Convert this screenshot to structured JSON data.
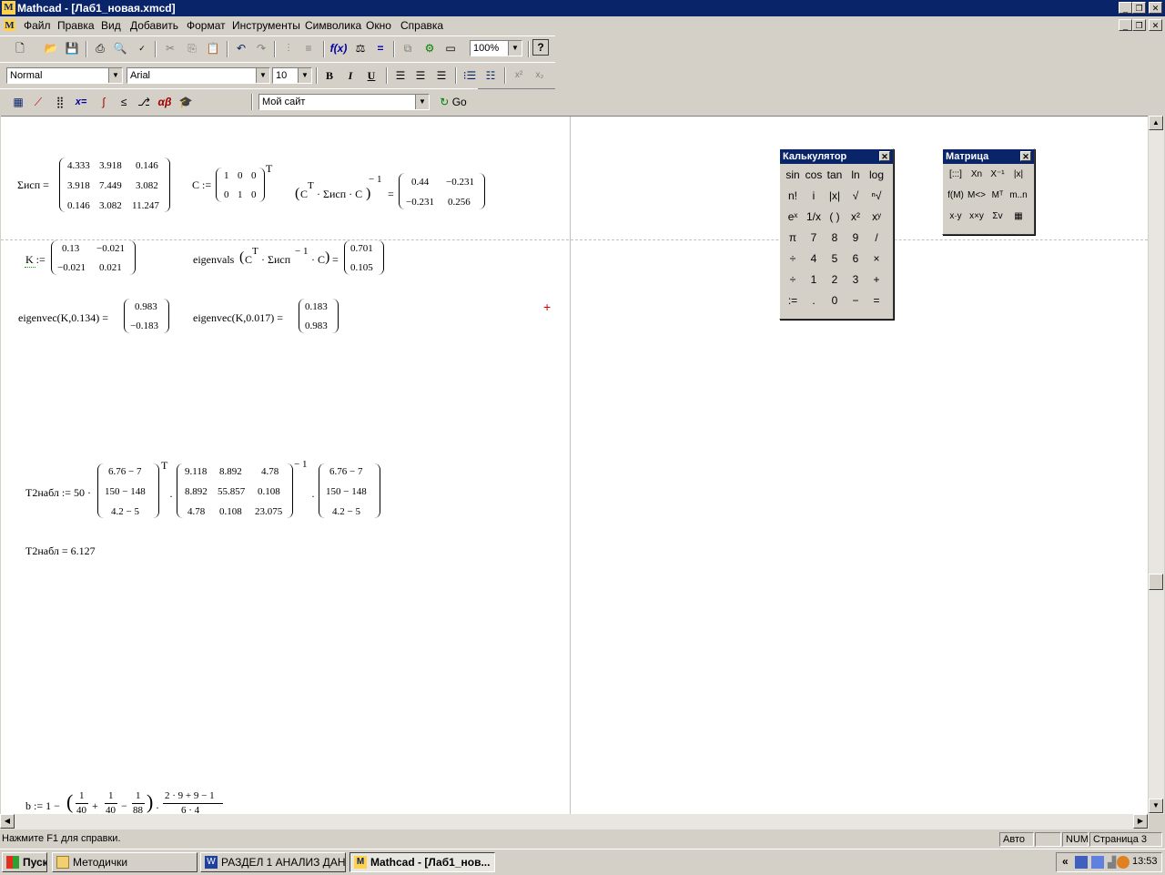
{
  "window": {
    "title": "Mathcad - [Лаб1_новая.xmcd]"
  },
  "menu": [
    "Файл",
    "Правка",
    "Вид",
    "Добавить",
    "Формат",
    "Инструменты",
    "Символика",
    "Окно",
    "Справка"
  ],
  "toolbar": {
    "zoom": "100%",
    "help": "?"
  },
  "format": {
    "style": "Normal",
    "font": "Arial",
    "size": "10",
    "bold": "B",
    "italic": "I",
    "underline": "U"
  },
  "math_toolbar": {
    "resource": "Мой сайт",
    "go": "Go"
  },
  "worksheet": {
    "sigma_lhs": "Σисп =",
    "sigma": [
      [
        "4.333",
        "3.918",
        "0.146"
      ],
      [
        "3.918",
        "7.449",
        "3.082"
      ],
      [
        "0.146",
        "3.082",
        "11.247"
      ]
    ],
    "c_lhs": "C :=",
    "c": [
      [
        "1",
        "0",
        "0"
      ],
      [
        "0",
        "1",
        "0"
      ]
    ],
    "t": "T",
    "ctsc_a": "C",
    "ctsc_b": "· Σисп · C",
    "minus1": "− 1",
    "eq": "=",
    "inv": [
      [
        "0.44",
        "−0.231"
      ],
      [
        "−0.231",
        "0.256"
      ]
    ],
    "k_lhs": "K :=",
    "k": [
      [
        "0.13",
        "−0.021"
      ],
      [
        "−0.021",
        "0.021"
      ]
    ],
    "eigvals_a": "eigenvals",
    "eigvals_b": "· Σисп",
    "eigvals_c": "· C",
    "eigvals": [
      "0.701",
      "0.105"
    ],
    "eigvec1_lhs": "eigenvec(K,0.134) =",
    "eigvec1": [
      "0.983",
      "−0.183"
    ],
    "eigvec2_lhs": "eigenvec(K,0.017) =",
    "eigvec2": [
      "0.183",
      "0.983"
    ],
    "t2_lhs": "T2набл := 50 ·",
    "dot": "·",
    "t2_v": [
      "6.76 − 7",
      "150 − 148",
      "4.2 − 5"
    ],
    "t2_m": [
      [
        "9.118",
        "8.892",
        "4.78"
      ],
      [
        "8.892",
        "55.857",
        "0.108"
      ],
      [
        "4.78",
        "0.108",
        "23.075"
      ]
    ],
    "t2_result": "T2набл = 6.127",
    "b_lhs": "b := 1 −",
    "b_frac_num": "1",
    "b_den1": "40",
    "b_den2": "40",
    "b_den3": "88",
    "b_plus": "+",
    "b_minus": "−",
    "b_num": "2 · 9 + 9 − 1",
    "b_den": "6 · 4"
  },
  "calculator": {
    "title": "Калькулятор",
    "rows": [
      [
        "sin",
        "cos",
        "tan",
        "ln",
        "log"
      ],
      [
        "n!",
        "i",
        "|x|",
        "√",
        "ⁿ√"
      ],
      [
        "eˣ",
        "1/x",
        "( )",
        "x²",
        "xʸ"
      ],
      [
        "π",
        "7",
        "8",
        "9",
        "/"
      ],
      [
        "÷",
        "4",
        "5",
        "6",
        "×"
      ],
      [
        "÷",
        "1",
        "2",
        "3",
        "+"
      ],
      [
        ":=",
        ".",
        "0",
        "−",
        "="
      ]
    ]
  },
  "matrix": {
    "title": "Матрица",
    "rows": [
      [
        "[:::]",
        "Xn",
        "X⁻¹",
        "|x|"
      ],
      [
        "f(M)",
        "M<>",
        "Mᵀ",
        "m..n"
      ],
      [
        "x·y",
        "x×y",
        "Σv",
        "▦"
      ]
    ]
  },
  "status": {
    "help": "Нажмите F1 для справки.",
    "mode": "Авто",
    "num": "NUM",
    "page": "Страница 3"
  },
  "taskbar": {
    "start": "Пуск",
    "tasks": [
      "Методички",
      "РАЗДЕЛ 1 АНАЛИЗ ДАН...",
      "Mathcad - [Лаб1_нов..."
    ],
    "tray_chevron": "«",
    "clock": "13:53"
  }
}
